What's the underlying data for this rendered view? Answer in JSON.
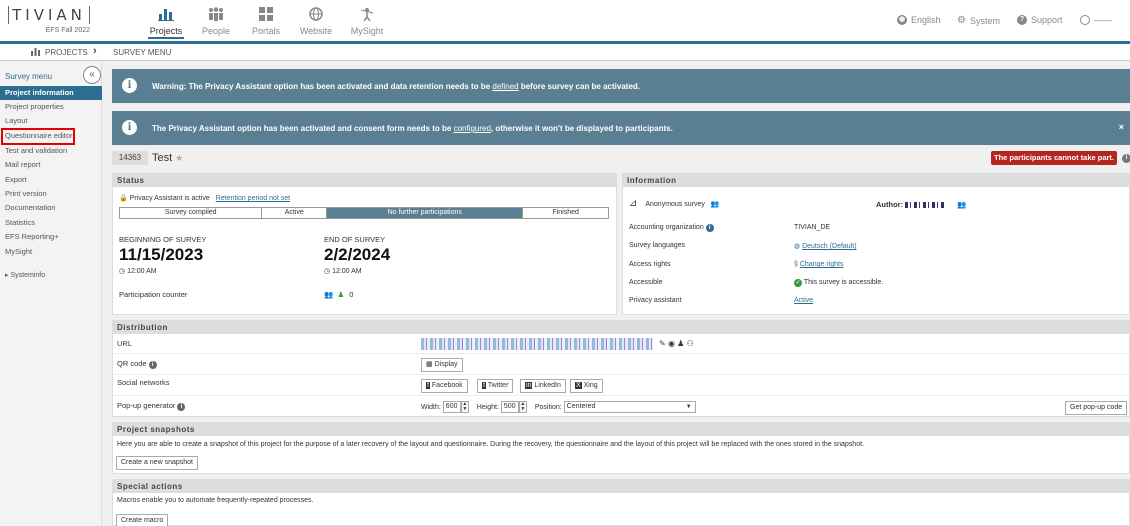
{
  "logo": {
    "name": "TIVIAN",
    "sub": "EFS Fall 2022"
  },
  "nav": [
    {
      "label": "Projects"
    },
    {
      "label": "People"
    },
    {
      "label": "Portals"
    },
    {
      "label": "Website"
    },
    {
      "label": "MySight"
    }
  ],
  "topright": {
    "language": "English",
    "system": "System",
    "support": "Support",
    "user": "——"
  },
  "breadcrumb": {
    "projects": "PROJECTS",
    "survey_menu": "SURVEY MENU"
  },
  "sidebar": {
    "heading": "Survey menu",
    "items": [
      {
        "label": "Project information"
      },
      {
        "label": "Project properties"
      },
      {
        "label": "Layout"
      },
      {
        "label": "Questionnaire editor"
      },
      {
        "label": "Test and validation"
      },
      {
        "label": "Mail report"
      },
      {
        "label": "Export"
      },
      {
        "label": "Print version"
      },
      {
        "label": "Documentation"
      },
      {
        "label": "Statistics"
      },
      {
        "label": "EFS Reporting+"
      },
      {
        "label": "MySight"
      }
    ],
    "systeminfo": "Systeminfo"
  },
  "banners": {
    "warning_pre": "Warning: The Privacy Assistant option has been activated and data retention needs to be ",
    "warning_link": "defined",
    "warning_post": " before survey can be activated.",
    "consent_pre": "The Privacy Assistant option has been activated and consent form needs to be ",
    "consent_link": "configured",
    "consent_post": ", otherwise it won't be displayed to participants.",
    "close": "×"
  },
  "project": {
    "id": "14363",
    "title": "Test",
    "cannot_take_part": "The participants cannot take part."
  },
  "status": {
    "heading": "Status",
    "privacy_active": "Privacy Assistant is active",
    "retention_link": "Retention period not set",
    "phases": [
      "Survey compiled",
      "Active",
      "No further participations",
      "Finished"
    ],
    "begin_label": "BEGINNING OF SURVEY",
    "begin_date": "11/15/2023",
    "begin_time": "12:00 AM",
    "end_label": "END OF SURVEY",
    "end_date": "2/2/2024",
    "end_time": "12:00 AM",
    "participation_label": "Participation counter",
    "participation_count": "0"
  },
  "information": {
    "heading": "Information",
    "anon": "Anonymous survey",
    "author_label": "Author:",
    "rows": [
      {
        "label": "Accounting organization",
        "value": "TIVIAN_DE"
      },
      {
        "label": "Survey languages",
        "value": "Deutsch (Default)"
      },
      {
        "label": "Access rights",
        "value": "Change rights"
      },
      {
        "label": "Accessible",
        "value": "This survey is accessible."
      },
      {
        "label": "Privacy assistant",
        "value": "Active"
      }
    ]
  },
  "distribution": {
    "heading": "Distribution",
    "url_label": "URL",
    "qr_label": "QR code",
    "qr_button": "Display",
    "social_label": "Social networks",
    "social": [
      "Facebook",
      "Twitter",
      "LinkedIn",
      "Xing"
    ],
    "popup_label": "Pop-up generator",
    "width_label": "Width:",
    "width_value": "600",
    "height_label": "Height:",
    "height_value": "500",
    "position_label": "Position:",
    "position_value": "Centered",
    "popup_button": "Get pop-up code"
  },
  "snapshots": {
    "heading": "Project snapshots",
    "desc": "Here you are able to create a snapshot of this project for the purpose of a later recovery of the layout and questionnaire. During the recovery, the questionnaire and the layout of this project will be replaced with the ones stored in the snapshot.",
    "button": "Create a new snapshot"
  },
  "special": {
    "heading": "Special actions",
    "desc": "Macros enable you to automate frequently-repeated processes.",
    "button": "Create macro"
  },
  "colors": {
    "accent": "#2c6e8f",
    "banner": "#5a7f93",
    "alert": "#b5261e",
    "highlight": "#e30000"
  }
}
